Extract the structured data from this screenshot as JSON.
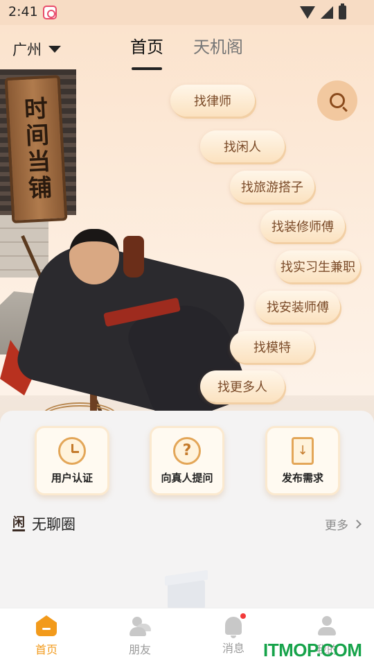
{
  "status_bar": {
    "time": "2:41"
  },
  "header": {
    "city": "广州",
    "tabs": [
      {
        "label": "首页",
        "active": true
      },
      {
        "label": "天机阁",
        "active": false
      }
    ]
  },
  "hero": {
    "sign_text": "时间当铺",
    "tags": [
      "找律师",
      "找闲人",
      "找旅游搭子",
      "找装修师傅",
      "找实习生兼职",
      "找安装师傅",
      "找模特",
      "找更多人"
    ]
  },
  "actions": [
    {
      "label": "用户认证",
      "icon": "clock-coin-icon"
    },
    {
      "label": "向真人提问",
      "icon": "question-clock-icon"
    },
    {
      "label": "发布需求",
      "icon": "document-icon"
    }
  ],
  "section": {
    "icon_text": "闲",
    "title": "无聊圈",
    "more": "更多"
  },
  "tabbar": [
    {
      "label": "首页",
      "icon": "home-icon",
      "active": true
    },
    {
      "label": "朋友",
      "icon": "friends-icon",
      "active": false
    },
    {
      "label": "消息",
      "icon": "bell-icon",
      "active": false,
      "badge": true
    },
    {
      "label": "我的",
      "icon": "user-icon",
      "active": false
    }
  ],
  "watermark": "ITMOP.COM",
  "colors": {
    "accent": "#f29a1b",
    "pill_text": "#7a4a28",
    "hero_bg": "#fbe3cd"
  }
}
